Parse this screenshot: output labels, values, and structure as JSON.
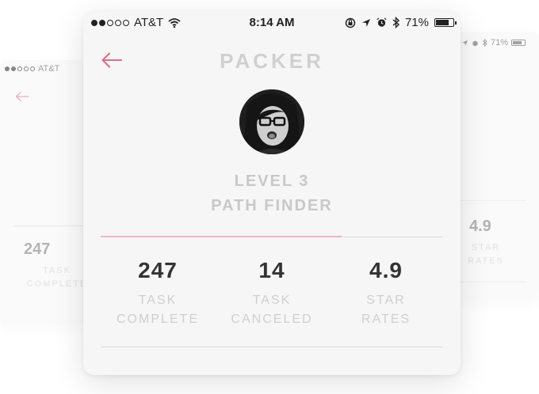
{
  "status_bar": {
    "carrier": "AT&T",
    "time": "8:14 AM",
    "battery": "71%"
  },
  "header": {
    "title": "PACKER"
  },
  "profile": {
    "level": "LEVEL 3",
    "subtitle": "PATH FINDER"
  },
  "stats": [
    {
      "value": "247",
      "label_line1": "TASK",
      "label_line2": "COMPLETE"
    },
    {
      "value": "14",
      "label_line1": "TASK",
      "label_line2": "CANCELED"
    },
    {
      "value": "4.9",
      "label_line1": "STAR",
      "label_line2": "RATES"
    }
  ],
  "back_left": {
    "carrier": "AT&T",
    "stat_value": "247",
    "stat_label_line1": "TASK",
    "stat_label_line2": "COMPLETE"
  },
  "back_right": {
    "battery": "71%",
    "stat_value": "4.9",
    "stat_label_line1": "STAR",
    "stat_label_line2": "RATES"
  },
  "colors": {
    "accent": "#e06a84",
    "card_bg": "#f6f6f6",
    "muted_text": "#c8c8c8",
    "stat_number": "#333333"
  },
  "icons": [
    "signal-dots-icon",
    "wifi-icon",
    "rotation-lock-icon",
    "location-arrow-icon",
    "alarm-icon",
    "bluetooth-icon",
    "battery-icon",
    "back-arrow-icon"
  ]
}
